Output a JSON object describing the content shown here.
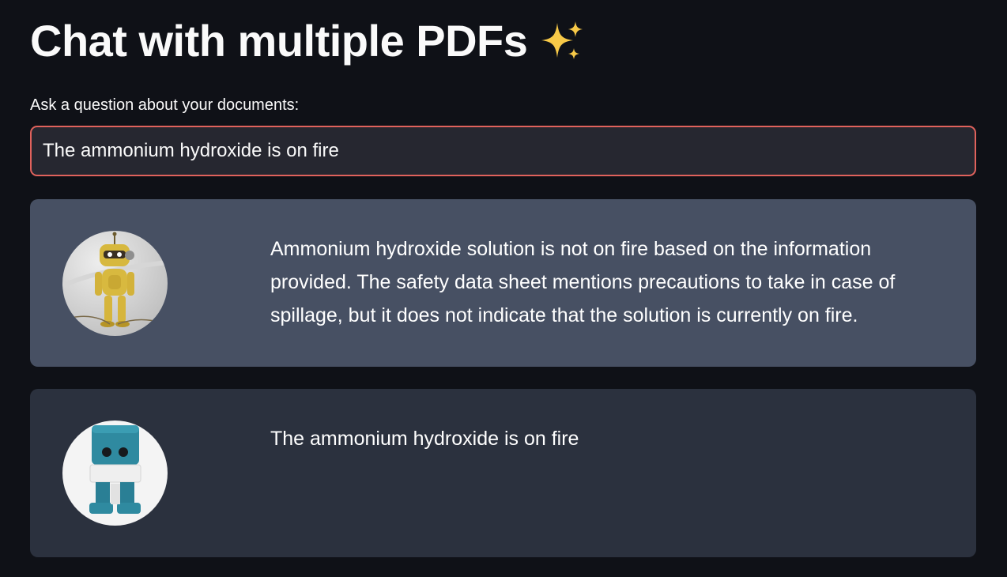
{
  "header": {
    "title": "Chat with multiple PDFs",
    "title_icon": "sparkles-icon"
  },
  "question": {
    "label": "Ask a question about your documents:",
    "value": "The ammonium hydroxide is on fire"
  },
  "messages": [
    {
      "role": "bot",
      "avatar": "robot-avatar",
      "text": "Ammonium hydroxide solution is not on fire based on the information provided. The safety data sheet mentions precautions to take in case of spillage, but it does not indicate that the solution is currently on fire."
    },
    {
      "role": "user",
      "avatar": "user-robot-avatar",
      "text": "The ammonium hydroxide is on fire"
    }
  ],
  "colors": {
    "background": "#0f1117",
    "input_border": "#e0625c",
    "input_background": "#262730",
    "bot_message_background": "#475063",
    "user_message_background": "#2b313e"
  }
}
